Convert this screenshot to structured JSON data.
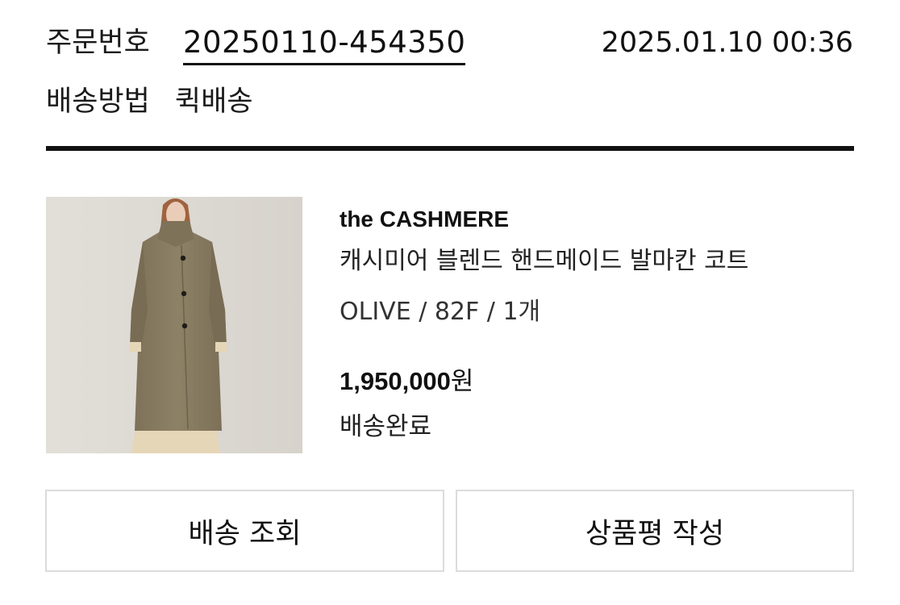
{
  "order": {
    "number_label": "주문번호",
    "number_value": "20250110-454350",
    "datetime": "2025.01.10 00:36",
    "shipping_label": "배송방법",
    "shipping_value": "퀵배송"
  },
  "item": {
    "image_icon": "product-photo-coat",
    "brand": "the CASHMERE",
    "name": "캐시미어 블렌드 핸드메이드 발마칸 코트",
    "option": "OLIVE / 82F / 1개",
    "price_value": "1,950,000",
    "price_unit": "원",
    "status": "배송완료"
  },
  "actions": {
    "track_label": "배송 조회",
    "review_label": "상품평 작성"
  },
  "colors": {
    "text": "#111111",
    "divider": "#111111",
    "button_border": "#dcdcdc",
    "coat": "#8a7d63"
  }
}
